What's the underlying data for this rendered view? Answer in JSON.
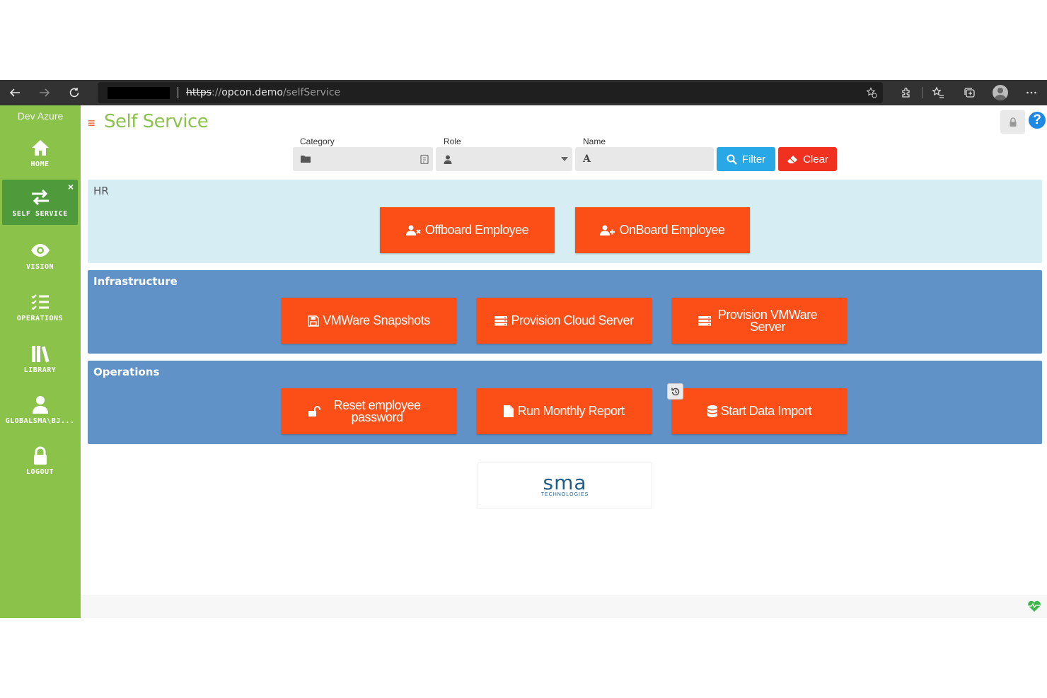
{
  "browser": {
    "url_protocol": "https",
    "url_sep": "://",
    "url_domain": "opcon.demo",
    "url_path": "/selfService"
  },
  "sidebar": {
    "environment": "Dev Azure",
    "items": [
      {
        "label": "HOME",
        "icon": "home-icon"
      },
      {
        "label": "SELF SERVICE",
        "icon": "exchange-icon",
        "active": true
      },
      {
        "label": "VISION",
        "icon": "eye-icon"
      },
      {
        "label": "OPERATIONS",
        "icon": "tasks-icon"
      },
      {
        "label": "LIBRARY",
        "icon": "library-icon"
      },
      {
        "label": "GLOBALSMA\\BJ...",
        "icon": "user-icon"
      },
      {
        "label": "LOGOUT",
        "icon": "lock-icon"
      }
    ],
    "close": "×"
  },
  "header": {
    "title": "Self Service",
    "menu_glyph": "≡",
    "help_glyph": "?"
  },
  "filters": {
    "category_label": "Category",
    "role_label": "Role",
    "name_label": "Name",
    "name_icon_glyph": "A",
    "filter_button": "Filter",
    "clear_button": "Clear"
  },
  "groups": [
    {
      "title": "HR",
      "buttons": [
        {
          "label": "Offboard Employee",
          "icon": "user-times-icon"
        },
        {
          "label": "OnBoard Employee",
          "icon": "user-plus-icon"
        }
      ]
    },
    {
      "title": "Infrastructure",
      "buttons": [
        {
          "label": "VMWare Snapshots",
          "icon": "floppy-icon"
        },
        {
          "label": "Provision Cloud Server",
          "icon": "server-icon"
        },
        {
          "label": "Provision VMWare Server",
          "icon": "server-icon"
        }
      ]
    },
    {
      "title": "Operations",
      "buttons": [
        {
          "label": "Reset employee password",
          "icon": "unlock-icon"
        },
        {
          "label": "Run Monthly Report",
          "icon": "file-icon"
        },
        {
          "label": "Start Data Import",
          "icon": "database-icon"
        }
      ]
    }
  ],
  "logo": {
    "text": "sma",
    "subtitle": "TECHNOLOGIES"
  },
  "colors": {
    "sidebar": "#8bc34a",
    "sidebar_active": "#4f9a3b",
    "action_button": "#fc4f17",
    "hr_group": "#d6eef3",
    "group_blue": "#6092c8",
    "filter_button": "#29a8e8",
    "clear_button": "#f0311f"
  }
}
